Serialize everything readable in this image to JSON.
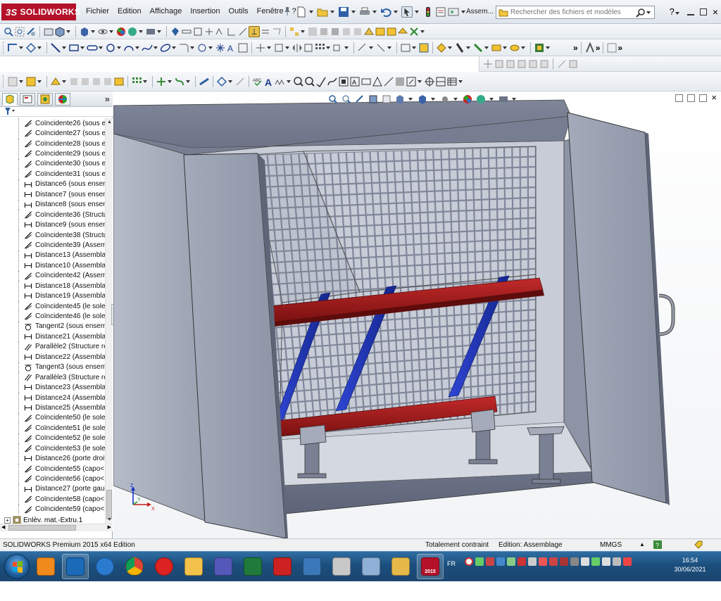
{
  "app": {
    "logo_text": "SOLIDWORKS",
    "logo_prefix": "3S",
    "brand_color": "#b4112a"
  },
  "menu": {
    "items": [
      "Fichier",
      "Edition",
      "Affichage",
      "Insertion",
      "Outils",
      "Fenêtre",
      "?"
    ],
    "assemble_label": "Assem...",
    "search_placeholder": "Rechercher des fichiers et modèles",
    "help_label": "?"
  },
  "feature_tree": {
    "items": [
      {
        "label": "Coïncidente26 (sous er",
        "icon": "coincident-icon"
      },
      {
        "label": "Coïncidente27 (sous er",
        "icon": "coincident-icon"
      },
      {
        "label": "Coïncidente28 (sous er",
        "icon": "coincident-icon"
      },
      {
        "label": "Coïncidente29 (sous er",
        "icon": "coincident-icon"
      },
      {
        "label": "Coïncidente30 (sous er",
        "icon": "coincident-icon"
      },
      {
        "label": "Coïncidente31 (sous er",
        "icon": "coincident-icon"
      },
      {
        "label": "Distance6 (sous ensem",
        "icon": "distance-icon"
      },
      {
        "label": "Distance7 (sous ensem",
        "icon": "distance-icon"
      },
      {
        "label": "Distance8 (sous ensem",
        "icon": "distance-icon"
      },
      {
        "label": "Coïncidente36 (Structu",
        "icon": "coincident-icon"
      },
      {
        "label": "Distance9 (sous ensem",
        "icon": "distance-icon"
      },
      {
        "label": "Coïncidente38 (Structu",
        "icon": "coincident-icon"
      },
      {
        "label": "Coïncidente39 (Assembl",
        "icon": "coincident-icon"
      },
      {
        "label": "Distance13 (Assemblag",
        "icon": "distance-icon"
      },
      {
        "label": "Distance10 (Assemblag",
        "icon": "distance-icon"
      },
      {
        "label": "Coïncidente42 (Assembl",
        "icon": "coincident-icon"
      },
      {
        "label": "Distance18 (Assemblag",
        "icon": "distance-icon"
      },
      {
        "label": "Distance19 (Assemblag",
        "icon": "distance-icon"
      },
      {
        "label": "Coïncidente45 (le sole",
        "icon": "coincident-icon"
      },
      {
        "label": "Coïncidente46 (le sole",
        "icon": "coincident-icon"
      },
      {
        "label": "Tangent2 (sous ensem",
        "icon": "tangent-icon"
      },
      {
        "label": "Distance21 (Assemblag",
        "icon": "distance-icon"
      },
      {
        "label": "Parallèle2 (Structure re",
        "icon": "parallel-icon"
      },
      {
        "label": "Distance22 (Assemblag",
        "icon": "distance-icon"
      },
      {
        "label": "Tangent3 (sous ensem",
        "icon": "tangent-icon"
      },
      {
        "label": "Parallèle3 (Structure re",
        "icon": "parallel-icon"
      },
      {
        "label": "Distance23 (Assemblag",
        "icon": "distance-icon"
      },
      {
        "label": "Distance24 (Assemblag",
        "icon": "distance-icon"
      },
      {
        "label": "Distance25 (Assemblag",
        "icon": "distance-icon"
      },
      {
        "label": "Coïncidente50 (le sole",
        "icon": "coincident-icon"
      },
      {
        "label": "Coïncidente51 (le sole",
        "icon": "coincident-icon"
      },
      {
        "label": "Coïncidente52 (le sole",
        "icon": "coincident-icon"
      },
      {
        "label": "Coïncidente53 (le sole",
        "icon": "coincident-icon"
      },
      {
        "label": "Distance26 (porte droit",
        "icon": "distance-icon"
      },
      {
        "label": "Coïncidente55 (capo<1",
        "icon": "coincident-icon"
      },
      {
        "label": "Coïncidente56 (capo<1",
        "icon": "coincident-icon"
      },
      {
        "label": "Distance27 (porte gauc",
        "icon": "distance-icon"
      },
      {
        "label": "Coïncidente58 (capo<1",
        "icon": "coincident-icon"
      },
      {
        "label": "Coïncidente59 (capo<1",
        "icon": "coincident-icon"
      }
    ],
    "last_item": "Enlèv. mat.-Extru.1"
  },
  "triad": {
    "x": "X",
    "y": "Y",
    "z": "Z"
  },
  "status": {
    "edition": "SOLIDWORKS Premium 2015 x64 Edition",
    "constraint": "Totalement contraint",
    "mode": "Edition: Assemblage",
    "units": "MMGS"
  },
  "taskbar": {
    "lang": "FR",
    "time": "16:54",
    "date": "30/06/2021",
    "apps": [
      "media-player-icon",
      "outlook-icon",
      "internet-explorer-icon",
      "chrome-icon",
      "opera-icon",
      "file-explorer-icon",
      "teams-icon",
      "excel-icon",
      "acrobat-icon",
      "photo-viewer-icon",
      "calculator-icon",
      "paint-icon",
      "folder-icon",
      "solidworks-2015-icon"
    ],
    "sw_badge": "2015"
  },
  "colors": {
    "model_gray": "#8e95a6",
    "beam_red": "#a31a1a",
    "brace_blue": "#1e35b8",
    "grid_line": "#9aa0ad"
  }
}
